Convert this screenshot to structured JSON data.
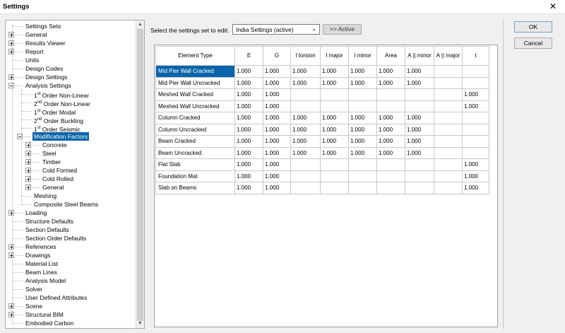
{
  "window": {
    "title": "Settings",
    "close_glyph": "✕"
  },
  "tree": {
    "items": [
      {
        "label": "Settings Sets"
      },
      {
        "label": "General"
      },
      {
        "label": "Results Viewer"
      },
      {
        "label": "Report"
      },
      {
        "label": "Units"
      },
      {
        "label": "Design Codes"
      },
      {
        "label": "Design Settings"
      },
      {
        "label": "Analysis Settings"
      },
      {
        "sup": "st",
        "rest": " Order Non-Linear",
        "num": "1"
      },
      {
        "sup": "nd",
        "rest": " Order Non-Linear",
        "num": "2"
      },
      {
        "sup": "st",
        "rest": " Order Modal",
        "num": "1"
      },
      {
        "sup": "nd",
        "rest": " Order Buckling",
        "num": "2"
      },
      {
        "sup": "st",
        "rest": " Order Seismic",
        "num": "1"
      },
      {
        "label": "Modification Factors"
      },
      {
        "label": "Concrete"
      },
      {
        "label": "Steel"
      },
      {
        "label": "Timber"
      },
      {
        "label": "Cold Formed"
      },
      {
        "label": "Cold Rolled"
      },
      {
        "label": "General"
      },
      {
        "label": "Meshing"
      },
      {
        "label": "Composite Steel Beams"
      },
      {
        "label": "Loading"
      },
      {
        "label": "Structure Defaults"
      },
      {
        "label": "Section Defaults"
      },
      {
        "label": "Section Order Defaults"
      },
      {
        "label": "References"
      },
      {
        "label": "Drawings"
      },
      {
        "label": "Material List"
      },
      {
        "label": "Beam Lines"
      },
      {
        "label": "Analysis Model"
      },
      {
        "label": "Solver"
      },
      {
        "label": "User Defined Attributes"
      },
      {
        "label": "Scene"
      },
      {
        "label": "Structural BIM"
      },
      {
        "label": "Embodied Carbon"
      }
    ],
    "scroll_up": "▲",
    "scroll_down": "▼"
  },
  "panel": {
    "settings_label": "Select the settings set to edit:",
    "settings_value": "India Settings (active)",
    "dropdown_glyph": "⌄",
    "active_button": ">> Active"
  },
  "grid": {
    "headers": [
      "Element Type",
      "E",
      "G",
      "I torsion",
      "I major",
      "I minor",
      "Area",
      "A || minor",
      "A || major",
      "t"
    ],
    "rows": [
      [
        "Mid Pier Wall Cracked",
        "1.000",
        "1.000",
        "1.000",
        "1.000",
        "1.000",
        "1.000",
        "1.000",
        "",
        ""
      ],
      [
        "Mid Pier Wall Uncracked",
        "1.000",
        "1.000",
        "1.000",
        "1.000",
        "1.000",
        "1.000",
        "1.000",
        "",
        ""
      ],
      [
        "Meshed Wall Cracked",
        "1.000",
        "1.000",
        "",
        "",
        "",
        "",
        "",
        "",
        "1.000"
      ],
      [
        "Meshed Wall Uncracked",
        "1.000",
        "1.000",
        "",
        "",
        "",
        "",
        "",
        "",
        "1.000"
      ],
      [
        "Column Cracked",
        "1.000",
        "1.000",
        "1.000",
        "1.000",
        "1.000",
        "1.000",
        "1.000",
        "",
        ""
      ],
      [
        "Column Uncracked",
        "1.000",
        "1.000",
        "1.000",
        "1.000",
        "1.000",
        "1.000",
        "1.000",
        "",
        ""
      ],
      [
        "Beam Cracked",
        "1.000",
        "1.000",
        "1.000",
        "1.000",
        "1.000",
        "1.000",
        "1.000",
        "",
        ""
      ],
      [
        "Beam Uncracked",
        "1.000",
        "1.000",
        "1.000",
        "1.000",
        "1.000",
        "1.000",
        "1.000",
        "",
        ""
      ],
      [
        "Flat Slab",
        "1.000",
        "1.000",
        "",
        "",
        "",
        "",
        "",
        "",
        "1.000"
      ],
      [
        "Foundation Mat",
        "1.000",
        "1.000",
        "",
        "",
        "",
        "",
        "",
        "",
        "1.000"
      ],
      [
        "Slab on Beams",
        "1.000",
        "1.000",
        "",
        "",
        "",
        "",
        "",
        "",
        "1.000"
      ]
    ]
  },
  "buttons": {
    "ok": "OK",
    "cancel": "Cancel"
  },
  "colors": {
    "selection": "#0a64a9"
  }
}
